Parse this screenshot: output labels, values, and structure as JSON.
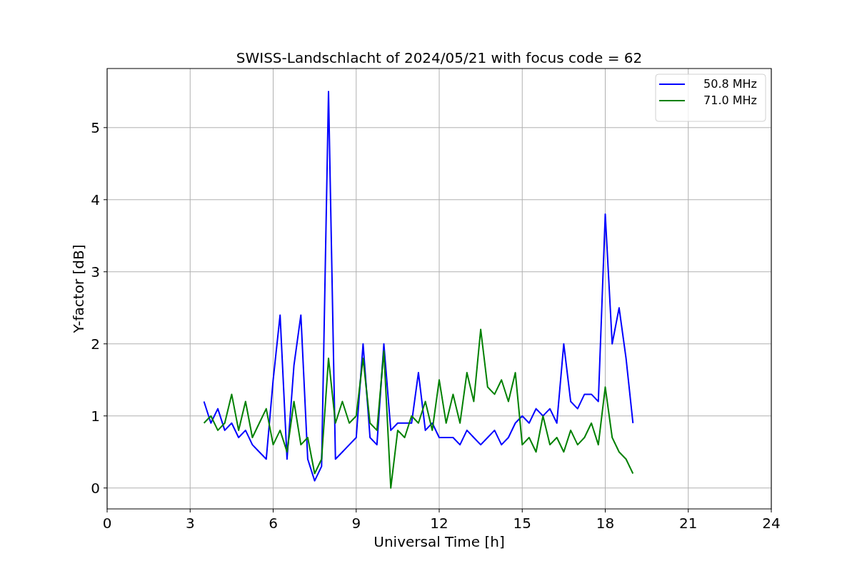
{
  "figure": {
    "chart_data": {
      "type": "line",
      "title": "SWISS-Landschlacht of 2024/05/21 with focus code = 62",
      "xlabel": "Universal Time [h]",
      "ylabel": "Y-factor [dB]",
      "x": [
        3.5,
        3.75,
        4,
        4.25,
        4.5,
        4.75,
        5,
        5.25,
        5.5,
        5.75,
        6,
        6.25,
        6.5,
        6.75,
        7,
        7.25,
        7.5,
        7.75,
        8,
        8.25,
        8.5,
        8.75,
        9,
        9.25,
        9.5,
        9.75,
        10,
        10.25,
        10.5,
        10.75,
        11,
        11.25,
        11.5,
        11.75,
        12,
        12.25,
        12.5,
        12.75,
        13,
        13.25,
        13.5,
        13.75,
        14,
        14.25,
        14.5,
        14.75,
        15,
        15.25,
        15.5,
        15.75,
        16,
        16.25,
        16.5,
        16.75,
        17,
        17.25,
        17.5,
        17.75,
        18,
        18.25,
        18.5,
        18.75,
        19
      ],
      "series": [
        {
          "name": "50.8 MHz",
          "color": "#0000ff",
          "values": [
            1.2,
            0.9,
            1.1,
            0.8,
            0.9,
            0.7,
            0.8,
            0.6,
            0.5,
            0.4,
            1.5,
            2.4,
            0.4,
            1.7,
            2.4,
            0.4,
            0.1,
            0.3,
            5.5,
            0.4,
            0.5,
            0.6,
            0.7,
            2.0,
            0.7,
            0.6,
            2.0,
            0.8,
            0.9,
            0.9,
            0.9,
            1.6,
            0.8,
            0.9,
            0.7,
            0.7,
            0.7,
            0.6,
            0.8,
            0.7,
            0.6,
            0.7,
            0.8,
            0.6,
            0.7,
            0.9,
            1.0,
            0.9,
            1.1,
            1.0,
            1.1,
            0.9,
            2.0,
            1.2,
            1.1,
            1.3,
            1.3,
            1.2,
            3.8,
            2.0,
            2.5,
            1.8,
            0.9
          ]
        },
        {
          "name": "71.0 MHz",
          "color": "#008000",
          "values": [
            0.9,
            1.0,
            0.8,
            0.9,
            1.3,
            0.8,
            1.2,
            0.7,
            0.9,
            1.1,
            0.6,
            0.8,
            0.5,
            1.2,
            0.6,
            0.7,
            0.2,
            0.4,
            1.8,
            0.9,
            1.2,
            0.9,
            1.0,
            1.8,
            0.9,
            0.8,
            1.9,
            0.0,
            0.8,
            0.7,
            1.0,
            0.9,
            1.2,
            0.8,
            1.5,
            0.9,
            1.3,
            0.9,
            1.6,
            1.2,
            2.2,
            1.4,
            1.3,
            1.5,
            1.2,
            1.6,
            0.6,
            0.7,
            0.5,
            1.0,
            0.6,
            0.7,
            0.5,
            0.8,
            0.6,
            0.7,
            0.9,
            0.6,
            1.4,
            0.7,
            0.5,
            0.4,
            0.2
          ]
        }
      ],
      "xlim": [
        0,
        24
      ],
      "ylim": [
        -0.29,
        5.82
      ],
      "xticks": [
        0,
        3,
        6,
        9,
        12,
        15,
        18,
        21,
        24
      ],
      "yticks": [
        0,
        1,
        2,
        3,
        4,
        5
      ],
      "grid": true,
      "legend": "upper right"
    }
  }
}
